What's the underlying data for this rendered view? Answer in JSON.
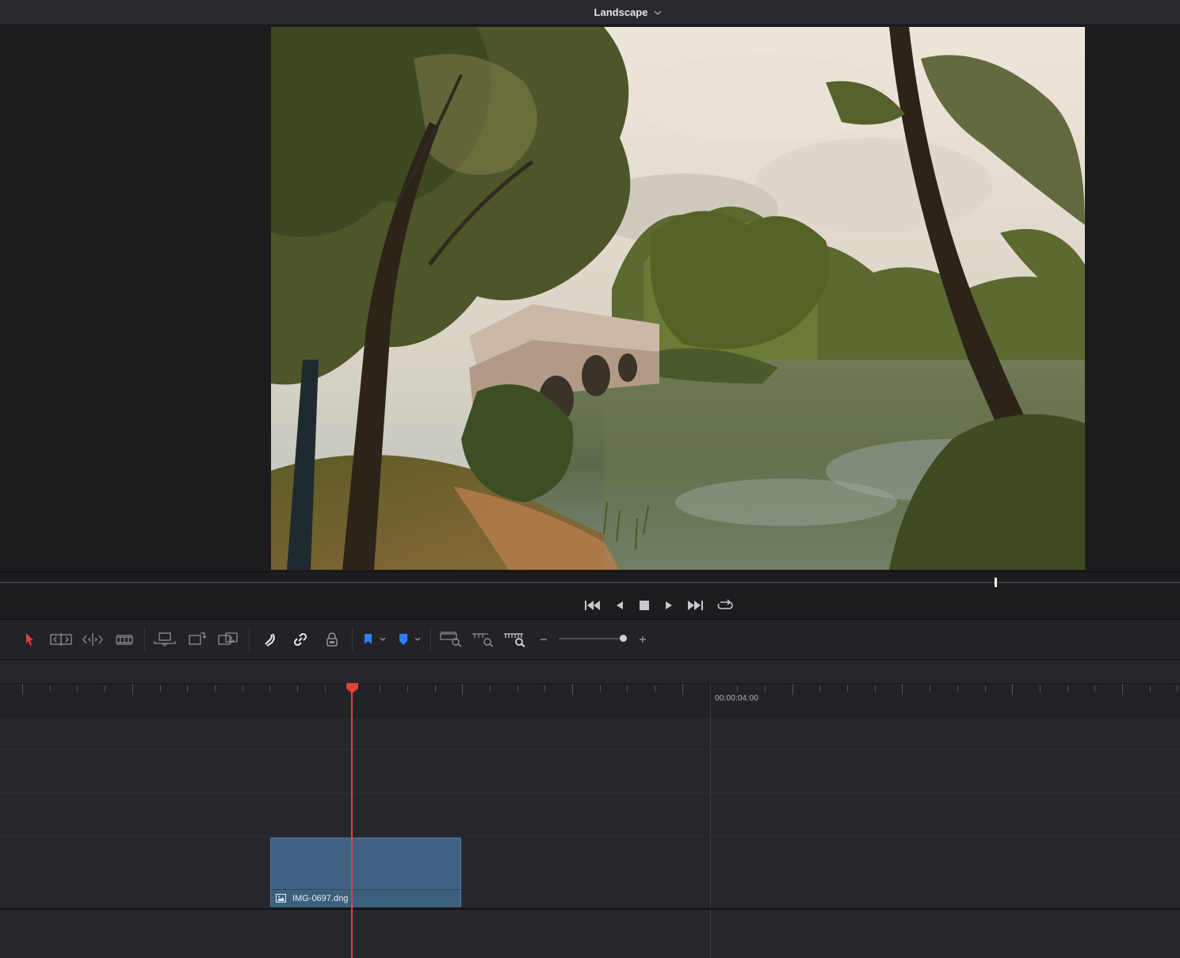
{
  "viewer": {
    "title": "Landscape"
  },
  "timeline": {
    "timecode": "00:00:04:00",
    "clip": {
      "name": "IMG-0697.dng"
    }
  },
  "colors": {
    "playhead": "#e0413a",
    "clip": "#3f6282",
    "marker_flag": "#2d7ff9",
    "select_tool": "#e0413a"
  },
  "transport_icons": [
    "skip-to-start-icon",
    "step-back-icon",
    "stop-icon",
    "play-icon",
    "skip-to-end-icon",
    "loop-icon"
  ],
  "toolbar_icons": [
    "selection-tool-icon",
    "trim-edit-icon",
    "dynamic-trim-icon",
    "blade-tool-icon",
    "overwrite-clip-icon",
    "replace-clip-icon",
    "place-on-top-icon",
    "snapping-icon",
    "linked-selection-icon",
    "position-lock-icon",
    "flag-icon",
    "marker-icon",
    "zoom-full-icon",
    "zoom-detail-icon",
    "zoom-custom-icon",
    "zoom-out-icon",
    "zoom-in-icon"
  ]
}
